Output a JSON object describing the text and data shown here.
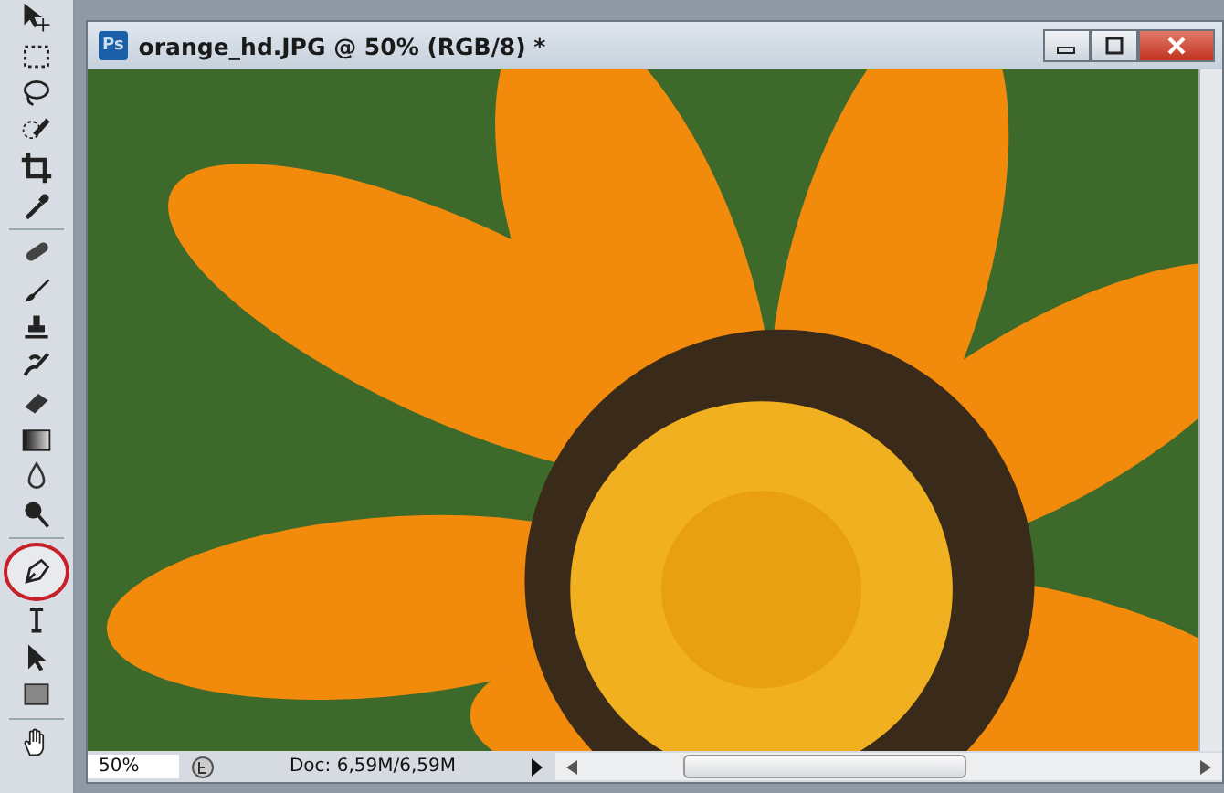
{
  "tools": [
    {
      "kind": "move",
      "selected": false
    },
    {
      "kind": "marquee",
      "selected": false
    },
    {
      "kind": "lasso",
      "selected": false
    },
    {
      "kind": "quick",
      "selected": false
    },
    {
      "kind": "crop",
      "selected": false
    },
    {
      "kind": "eyedropper",
      "selected": false
    },
    {
      "kind": "healing",
      "selected": false
    },
    {
      "kind": "brush",
      "selected": false
    },
    {
      "kind": "stamp",
      "selected": false
    },
    {
      "kind": "history",
      "selected": false
    },
    {
      "kind": "eraser",
      "selected": false
    },
    {
      "kind": "gradient",
      "selected": false
    },
    {
      "kind": "blur",
      "selected": false
    },
    {
      "kind": "dodge",
      "selected": false
    },
    {
      "kind": "pen",
      "selected": true
    },
    {
      "kind": "type",
      "selected": false
    },
    {
      "kind": "pathsel",
      "selected": false
    },
    {
      "kind": "shape",
      "selected": false
    },
    {
      "kind": "hand",
      "selected": false
    }
  ],
  "document": {
    "app_badge": "Ps",
    "title": "orange_hd.JPG @ 50% (RGB/8) *"
  },
  "status_bar": {
    "zoom": "50%",
    "doc_info": "Doc: 6,59M/6,59M"
  }
}
